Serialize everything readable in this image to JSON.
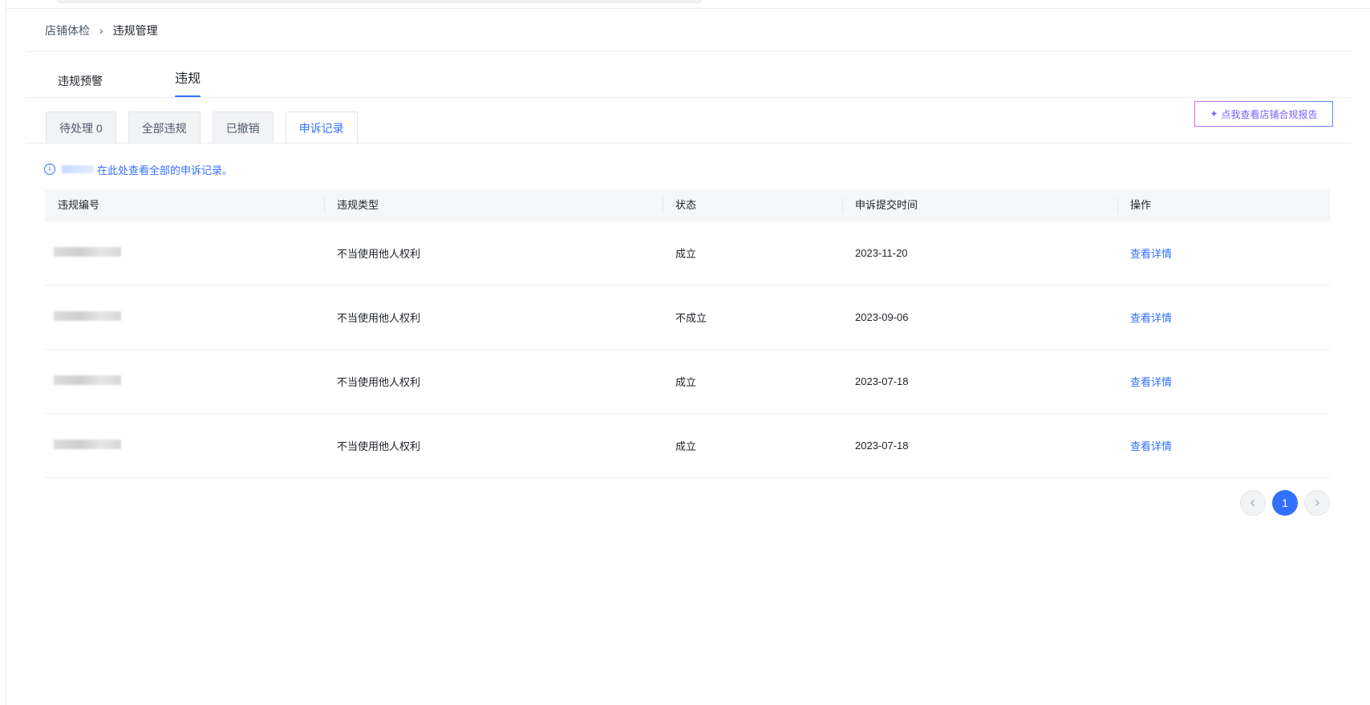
{
  "breadcrumb": {
    "parent": "店铺体检",
    "separator": "›",
    "current": "违规管理"
  },
  "main_tabs": [
    {
      "label": "违规预警"
    },
    {
      "label": "违规"
    }
  ],
  "sub_tabs": [
    {
      "label": "待处理 0"
    },
    {
      "label": "全部违规"
    },
    {
      "label": "已撤销"
    },
    {
      "label": "申诉记录"
    }
  ],
  "compliance_button": {
    "icon": "sparkle-icon",
    "label": "点我查看店铺合规报告"
  },
  "notice": {
    "icon": "info-icon",
    "text": "在此处查看全部的申诉记录。"
  },
  "table": {
    "headers": [
      "违规编号",
      "违规类型",
      "状态",
      "申诉提交时间",
      "操作"
    ],
    "rows": [
      {
        "type": "不当使用他人权利",
        "status": "成立",
        "time": "2023-11-20",
        "action": "查看详情"
      },
      {
        "type": "不当使用他人权利",
        "status": "不成立",
        "time": "2023-09-06",
        "action": "查看详情"
      },
      {
        "type": "不当使用他人权利",
        "status": "成立",
        "time": "2023-07-18",
        "action": "查看详情"
      },
      {
        "type": "不当使用他人权利",
        "status": "成立",
        "time": "2023-07-18",
        "action": "查看详情"
      }
    ]
  },
  "pagination": {
    "prev_icon": "chevron-left-icon",
    "current_page": "1",
    "next_icon": "chevron-right-icon"
  },
  "colors": {
    "accent": "#3370ff",
    "header_bg": "#f5f6f7"
  }
}
